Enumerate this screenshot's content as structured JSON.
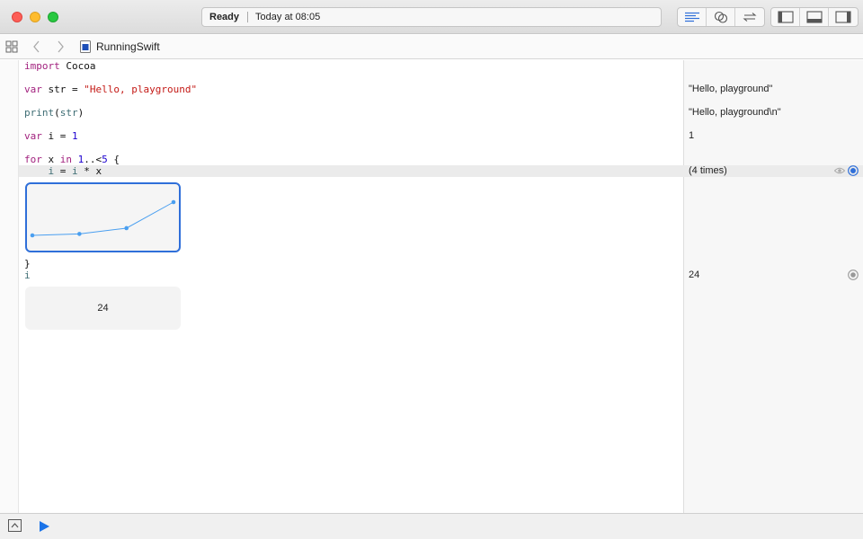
{
  "window": {
    "status": "Ready",
    "timestamp": "Today at 08:05"
  },
  "toolbar": {
    "editor_buttons": [
      "standard-editor-icon",
      "assistant-editor-icon",
      "version-editor-icon"
    ],
    "view_buttons": [
      "navigator-toggle-icon",
      "debug-area-toggle-icon",
      "utilities-toggle-icon"
    ]
  },
  "jumpbar": {
    "file_name": "RunningSwift"
  },
  "code": {
    "lines": [
      {
        "kw": "import",
        "rest": " Cocoa"
      },
      {
        "kw": "var",
        "rest": " str = ",
        "str": "\"Hello, playground\""
      },
      {
        "fn": "print",
        "rest": "(",
        "var": "str",
        "tail": ")"
      },
      {
        "kw": "var",
        "rest": " i = ",
        "num": "1"
      },
      {
        "kw": "for",
        "a": " x ",
        "kw2": "in",
        "num": " 1",
        "b": "..<",
        "num2": "5",
        "c": " {"
      },
      {
        "indent": "    ",
        "var": "i",
        "a": " = ",
        "var2": "i",
        "b": " * x"
      },
      {
        "text": "}"
      },
      {
        "var": "i"
      }
    ]
  },
  "results": {
    "r1": "\"Hello, playground\"",
    "r2": "\"Hello, playground\\n\"",
    "r3": "1",
    "r4": "(4 times)",
    "r5": "24"
  },
  "inline_value": "24",
  "chart_data": {
    "type": "line",
    "x": [
      1,
      2,
      3,
      4
    ],
    "values": [
      1,
      2,
      6,
      24
    ],
    "color": "#4a9ff0"
  },
  "colors": {
    "keyword": "#a2217e",
    "string": "#c41a16",
    "number": "#1c00cf",
    "accent": "#2f6fd9",
    "run": "#1a73e8"
  }
}
